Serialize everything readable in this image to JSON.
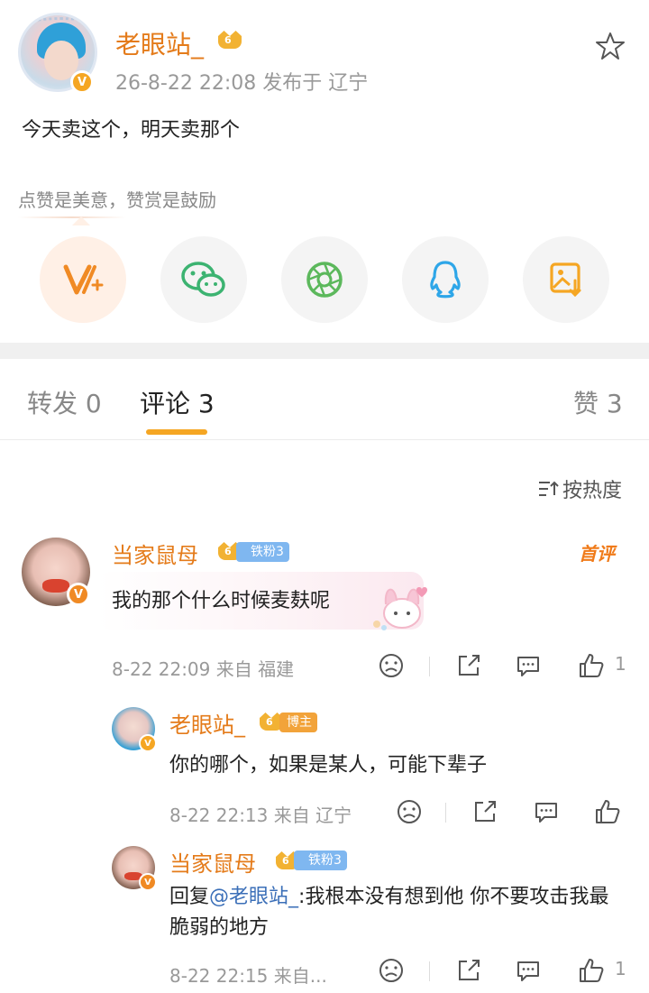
{
  "post": {
    "author": "老眼站_",
    "crown_level": "6",
    "verified_mark": "V",
    "meta": "26-8-22 22:08  发布于 辽宁",
    "text": "今天卖这个，明天卖那个",
    "reward_tip": "点赞是美意，赞赏是鼓励"
  },
  "share_icons": [
    "vplus-reward-icon",
    "wechat-icon",
    "moments-icon",
    "qq-icon",
    "save-image-icon"
  ],
  "tabs": {
    "repost": "转发 0",
    "comments": "评论 3",
    "likes": "赞 3"
  },
  "sort": {
    "label": "按热度"
  },
  "comments": [
    {
      "author": "当家鼠母",
      "crown_level": "6",
      "fan_badge": "铁粉3",
      "first_tag": "首评",
      "text": "我的那个什么时候麦麸呢",
      "time": "8-22 22:09  来自 福建",
      "like_count": "1"
    }
  ],
  "replies": [
    {
      "author": "老眼站_",
      "crown_level": "6",
      "role_badge": "博主",
      "text": "你的哪个，如果是某人，可能下辈子",
      "time": "8-22 22:13  来自 辽宁"
    },
    {
      "author": "当家鼠母",
      "crown_level": "6",
      "fan_badge": "铁粉3",
      "text_prefix": "回复",
      "mention": "@老眼站_",
      "text_body": ":我根本没有想到他 你不要攻击我最脆弱的地方",
      "time": "8-22 22:15  来自...",
      "like_count": "1"
    }
  ],
  "colors": {
    "accent": "#f5a623",
    "username": "#e47b1a",
    "mention": "#3b6fb8"
  }
}
